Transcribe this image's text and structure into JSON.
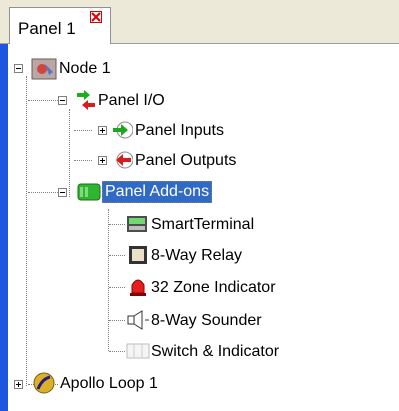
{
  "tab": {
    "label": "Panel 1"
  },
  "tree": {
    "node": "Node 1",
    "panel_io": "Panel I/O",
    "panel_inputs": "Panel Inputs",
    "panel_outputs": "Panel Outputs",
    "panel_addons": "Panel Add-ons",
    "smart_terminal": "SmartTerminal",
    "relay": "8-Way Relay",
    "zone_indicator": "32 Zone Indicator",
    "sounder": "8-Way Sounder",
    "switch_indicator": "Switch & Indicator",
    "apollo_loop": "Apollo Loop 1"
  },
  "colors": {
    "selection": "#316ac5",
    "accent_bar": "#1d54e0"
  }
}
